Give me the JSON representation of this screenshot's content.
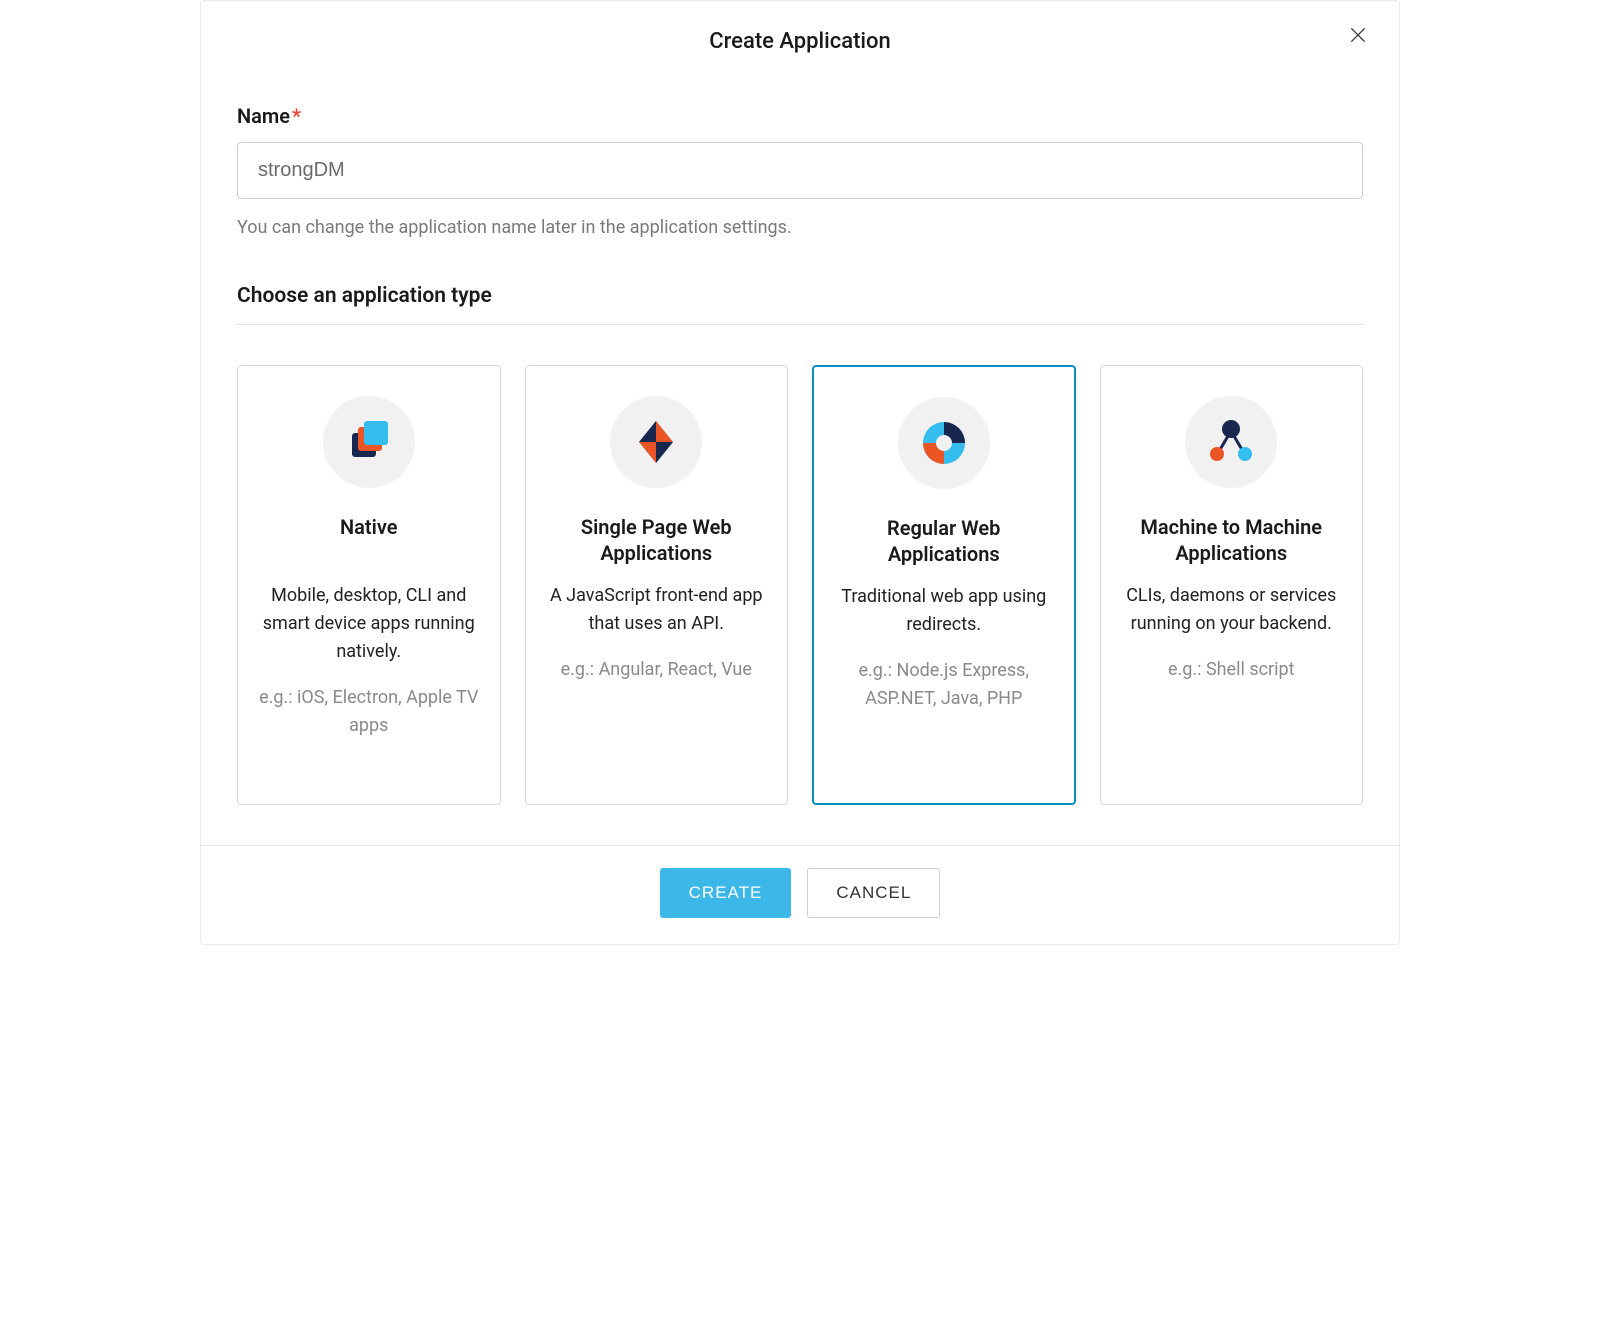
{
  "modal": {
    "title": "Create Application"
  },
  "form": {
    "name_label": "Name",
    "name_value": "strongDM",
    "name_helper": "You can change the application name later in the application settings."
  },
  "type_section": {
    "heading": "Choose an application type",
    "selected_index": 2,
    "cards": [
      {
        "title": "Native",
        "description": "Mobile, desktop, CLI and smart device apps running natively.",
        "examples": "e.g.: iOS, Electron, Apple TV apps"
      },
      {
        "title": "Single Page Web Applications",
        "description": "A JavaScript front-end app that uses an API.",
        "examples": "e.g.: Angular, React, Vue"
      },
      {
        "title": "Regular Web Applications",
        "description": "Traditional web app using redirects.",
        "examples": "e.g.: Node.js Express, ASP.NET, Java, PHP"
      },
      {
        "title": "Machine to Machine Applications",
        "description": "CLIs, daemons or services running on your backend.",
        "examples": "e.g.: Shell script"
      }
    ]
  },
  "footer": {
    "create_label": "CREATE",
    "cancel_label": "CANCEL"
  }
}
